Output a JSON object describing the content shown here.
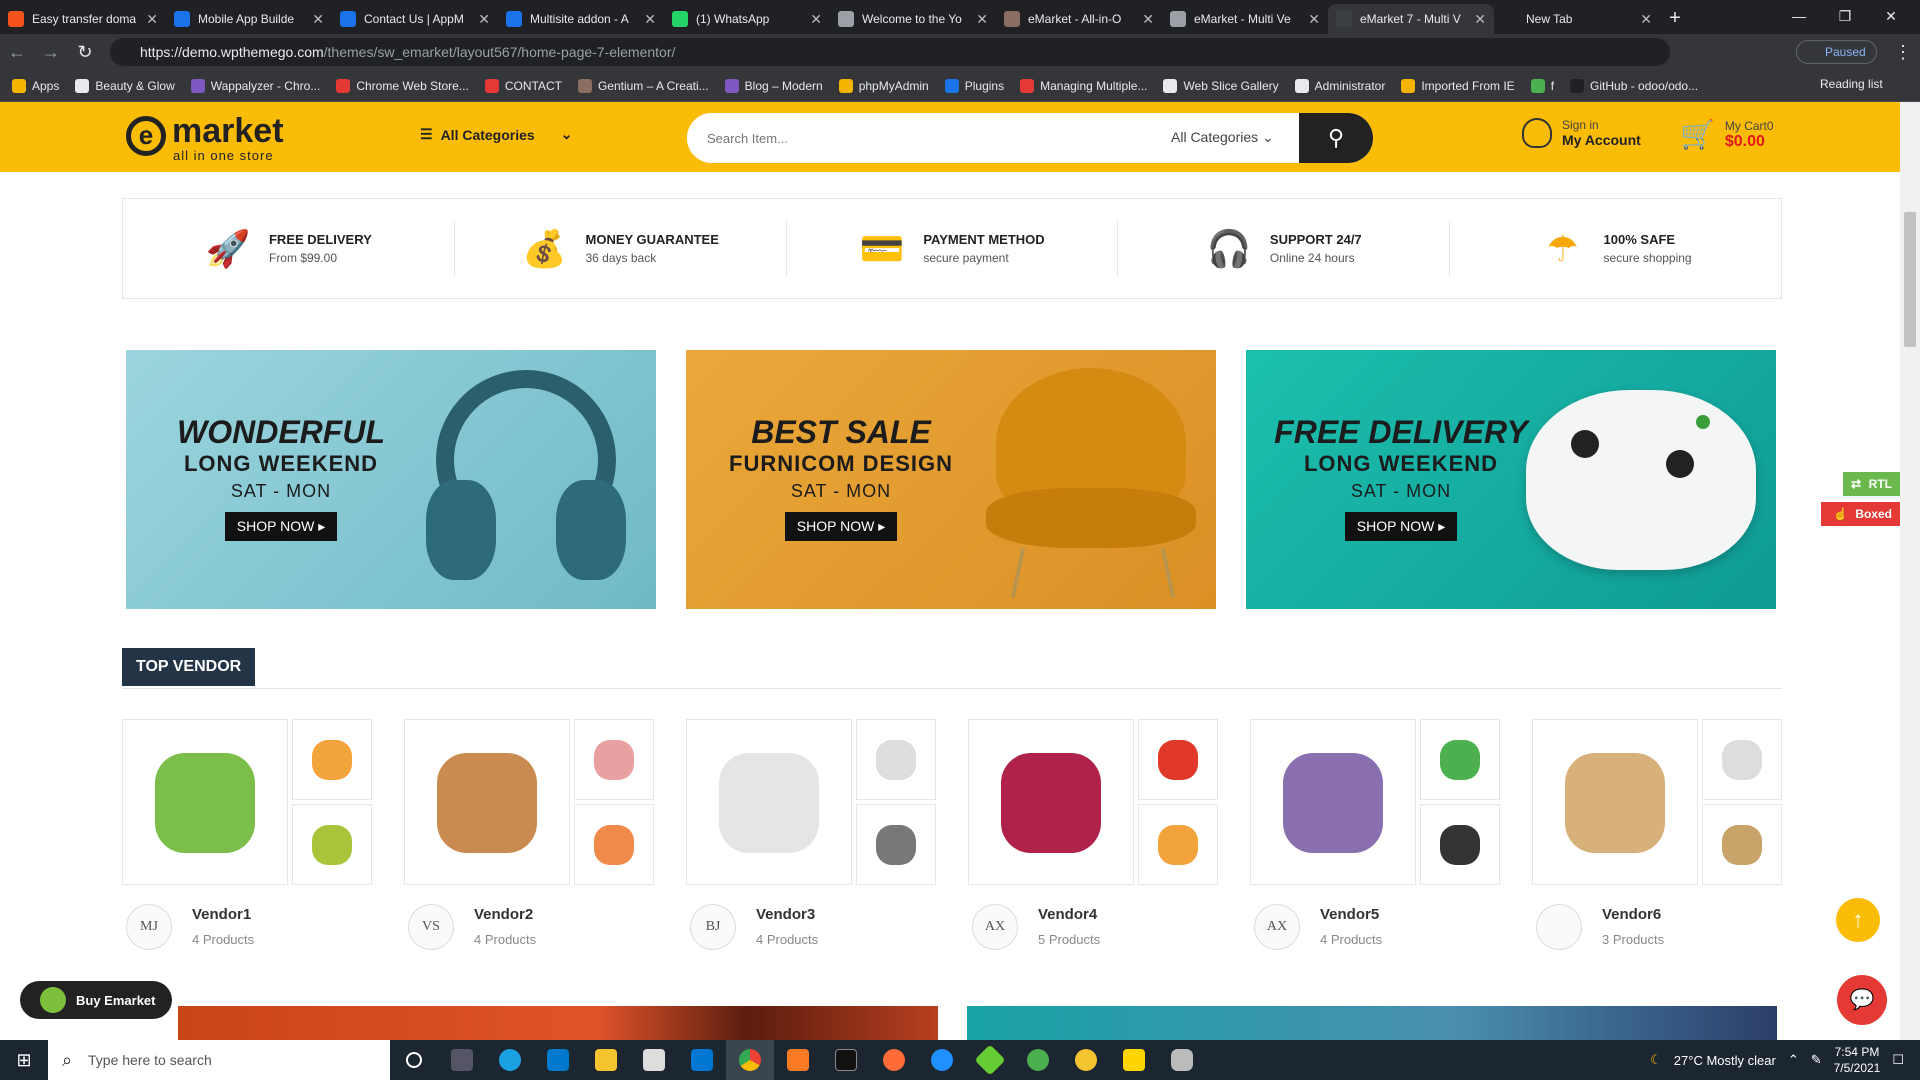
{
  "browser": {
    "tabs": [
      {
        "title": "Easy transfer doma",
        "color": "#f4511e",
        "active": false
      },
      {
        "title": "Mobile App Builde",
        "color": "#1a73e8",
        "active": false
      },
      {
        "title": "Contact Us | AppM",
        "color": "#1a73e8",
        "active": false
      },
      {
        "title": "Multisite addon - A",
        "color": "#1a73e8",
        "active": false
      },
      {
        "title": "(1) WhatsApp",
        "color": "#25d366",
        "active": false
      },
      {
        "title": "Welcome to the Yo",
        "color": "#9aa0a6",
        "active": false
      },
      {
        "title": "eMarket - All-in-O",
        "color": "#8d6e63",
        "active": false
      },
      {
        "title": "eMarket - Multi Ve",
        "color": "#9aa0a6",
        "active": false
      },
      {
        "title": "eMarket 7 - Multi V",
        "color": "#3c4043",
        "active": true
      },
      {
        "title": "New Tab",
        "color": "transparent",
        "active": false
      }
    ],
    "url_host": "https://demo.wpthemego.com",
    "url_path": "/themes/sw_emarket/layout567/home-page-7-elementor/",
    "profile_status": "Paused",
    "bookmarks": [
      {
        "label": "Apps",
        "color": "#f4b400"
      },
      {
        "label": "Beauty & Glow",
        "color": "#e8eaed"
      },
      {
        "label": "Wappalyzer - Chro...",
        "color": "#7e57c2"
      },
      {
        "label": "Chrome Web Store...",
        "color": "#e53935"
      },
      {
        "label": "CONTACT",
        "color": "#e53935"
      },
      {
        "label": "Gentium – A Creati...",
        "color": "#8d6e63"
      },
      {
        "label": "Blog – Modern",
        "color": "#7e57c2"
      },
      {
        "label": "phpMyAdmin",
        "color": "#f4b400"
      },
      {
        "label": "Plugins",
        "color": "#1a73e8"
      },
      {
        "label": "Managing Multiple...",
        "color": "#e53935"
      },
      {
        "label": "Web Slice Gallery",
        "color": "#e8eaed"
      },
      {
        "label": "Administrator",
        "color": "#e8eaed"
      },
      {
        "label": "Imported From IE",
        "color": "#f4b400"
      },
      {
        "label": "f",
        "color": "#4caf50"
      },
      {
        "label": "GitHub - odoo/odo...",
        "color": "#202124"
      }
    ],
    "reading_list": "Reading list"
  },
  "header": {
    "logo_main": "market",
    "logo_letter": "e",
    "logo_sub": "all in one store",
    "categories_label": "All Categories",
    "search_placeholder": "Search Item...",
    "search_category": "All Categories",
    "signin": "Sign in",
    "account": "My Account",
    "cart_label": "My Cart0",
    "cart_total": "$0.00",
    "brand_color": "#fbbc05"
  },
  "features": [
    {
      "icon": "rocket-icon",
      "title": "FREE DELIVERY",
      "desc": "From $99.00"
    },
    {
      "icon": "wallet-icon",
      "title": "MONEY GUARANTEE",
      "desc": "36 days back"
    },
    {
      "icon": "payment-icon",
      "title": "PAYMENT METHOD",
      "desc": "secure payment"
    },
    {
      "icon": "headphones-icon",
      "title": "SUPPORT 24/7",
      "desc": "Online 24 hours"
    },
    {
      "icon": "umbrella-icon",
      "title": "100% SAFE",
      "desc": "secure shopping"
    }
  ],
  "banners": [
    {
      "line1": "WONDERFUL",
      "line2": "LONG WEEKEND",
      "line3": "SAT - MON",
      "button": "SHOP NOW",
      "bg": "#8fcfd8",
      "product": "headphones"
    },
    {
      "line1": "BEST SALE",
      "line2": "FURNICOM DESIGN",
      "line3": "SAT - MON",
      "button": "SHOP NOW",
      "bg": "#e8a233",
      "product": "armchair"
    },
    {
      "line1": "FREE DELIVERY",
      "line2": "LONG WEEKEND",
      "line3": "SAT - MON",
      "button": "SHOP NOW",
      "bg": "#17b3a5",
      "product": "game-controller"
    }
  ],
  "top_vendor_title": "TOP VENDOR",
  "vendors": [
    {
      "name": "Vendor1",
      "count": "4 Products",
      "avatar": "MJ"
    },
    {
      "name": "Vendor2",
      "count": "4 Products",
      "avatar": "VS"
    },
    {
      "name": "Vendor3",
      "count": "4 Products",
      "avatar": "BJ"
    },
    {
      "name": "Vendor4",
      "count": "5 Products",
      "avatar": "AX"
    },
    {
      "name": "Vendor5",
      "count": "4 Products",
      "avatar": "AX"
    },
    {
      "name": "Vendor6",
      "count": "3 Products",
      "avatar": ""
    }
  ],
  "floating": {
    "buy": "Buy Emarket",
    "rtl": "RTL",
    "boxed": "Boxed"
  },
  "taskbar": {
    "search_placeholder": "Type here to search",
    "weather": "27°C  Mostly clear",
    "time": "7:54 PM",
    "date": "7/5/2021"
  }
}
